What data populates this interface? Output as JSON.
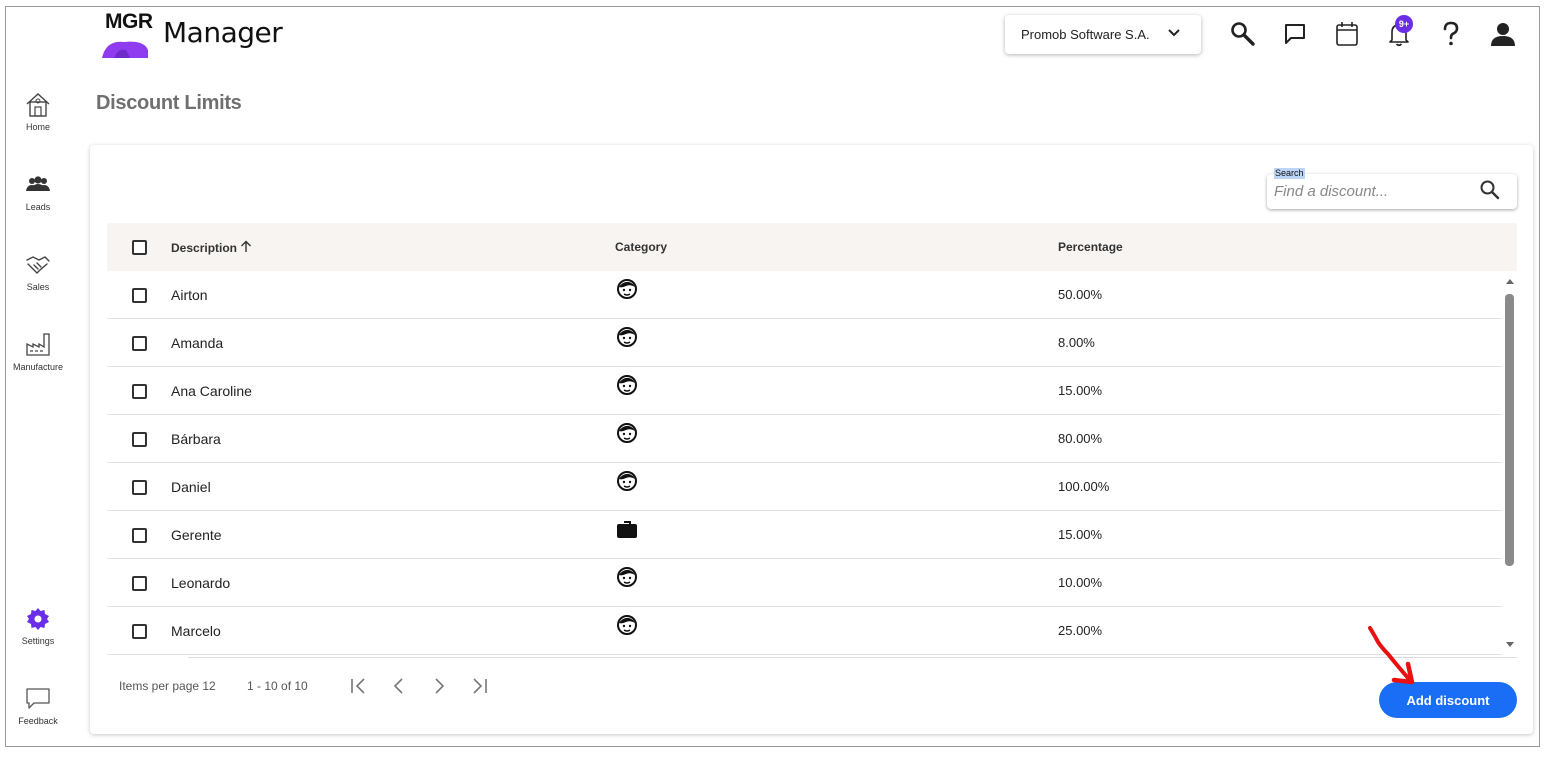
{
  "app": {
    "logo_text": "MGR",
    "title": "Manager"
  },
  "header": {
    "company_select": "Promob Software S.A.",
    "notification_badge": "9+"
  },
  "sidebar": {
    "items": [
      {
        "label": "Home",
        "icon": "home-icon"
      },
      {
        "label": "Leads",
        "icon": "leads-icon"
      },
      {
        "label": "Sales",
        "icon": "handshake-icon"
      },
      {
        "label": "Manufacture",
        "icon": "factory-icon"
      }
    ],
    "bottom_items": [
      {
        "label": "Settings",
        "icon": "gear-icon"
      },
      {
        "label": "Feedback",
        "icon": "feedback-icon"
      }
    ]
  },
  "page": {
    "title": "Discount Limits"
  },
  "search": {
    "label": "Search",
    "placeholder": "Find a discount..."
  },
  "table": {
    "columns": [
      "Description",
      "Category",
      "Percentage"
    ],
    "sort_column": "Description",
    "sort_direction": "ascending",
    "rows": [
      {
        "description": "Airton",
        "category": "user-face-icon",
        "percentage": "50.00%"
      },
      {
        "description": "Amanda",
        "category": "user-face-icon",
        "percentage": "8.00%"
      },
      {
        "description": "Ana Caroline",
        "category": "user-face-icon",
        "percentage": "15.00%"
      },
      {
        "description": "Bárbara",
        "category": "user-face-icon",
        "percentage": "80.00%"
      },
      {
        "description": "Daniel",
        "category": "user-face-icon",
        "percentage": "100.00%"
      },
      {
        "description": "Gerente",
        "category": "briefcase-icon",
        "percentage": "15.00%"
      },
      {
        "description": "Leonardo",
        "category": "user-face-icon",
        "percentage": "10.00%"
      },
      {
        "description": "Marcelo",
        "category": "user-face-icon",
        "percentage": "25.00%"
      }
    ]
  },
  "pagination": {
    "items_per_page": "Items per page 12",
    "range": "1 - 10 of 10"
  },
  "actions": {
    "add_discount": "Add discount"
  },
  "colors": {
    "accent": "#1a6ef5",
    "brand_purple": "#8f3cf0",
    "badge": "#6a2ee8"
  }
}
